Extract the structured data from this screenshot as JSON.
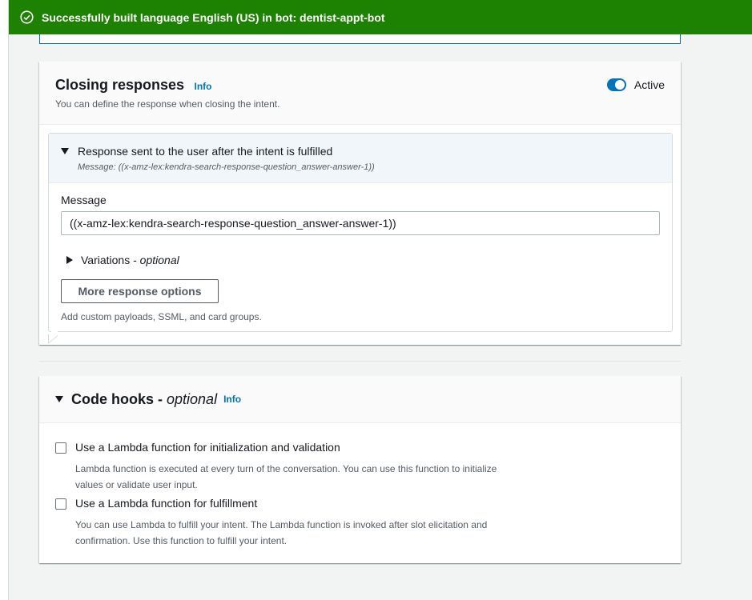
{
  "flash": {
    "icon": "check-circle-icon",
    "message": "Successfully built language English (US) in bot: dentist-appt-bot",
    "color": "#1d8102"
  },
  "closing": {
    "title": "Closing responses",
    "info": "Info",
    "description": "You can define the response when closing the intent.",
    "toggle_label": "Active",
    "toggle_on": true,
    "expander": {
      "title": "Response sent to the user after the intent is fulfilled",
      "subtitle": "Message: ((x-amz-lex:kendra-search-response-question_answer-answer-1))"
    },
    "message_label": "Message",
    "message_value": "((x-amz-lex:kendra-search-response-question_answer-answer-1))",
    "variations_label": "Variations - ",
    "variations_optional": "optional",
    "more_button": "More response options",
    "more_desc": "Add custom payloads, SSML, and card groups."
  },
  "code_hooks": {
    "title": "Code hooks - ",
    "optional": "optional",
    "info": "Info",
    "items": [
      {
        "label": "Use a Lambda function for initialization and validation",
        "desc": "Lambda function is executed at every turn of the conversation. You can use this function to initialize values or validate user input.",
        "checked": false
      },
      {
        "label": "Use a Lambda function for fulfillment",
        "desc": "You can use Lambda to fulfill your intent. The Lambda function is invoked after slot elicitation and confirmation. Use this function to fulfill your intent.",
        "checked": false
      }
    ]
  }
}
